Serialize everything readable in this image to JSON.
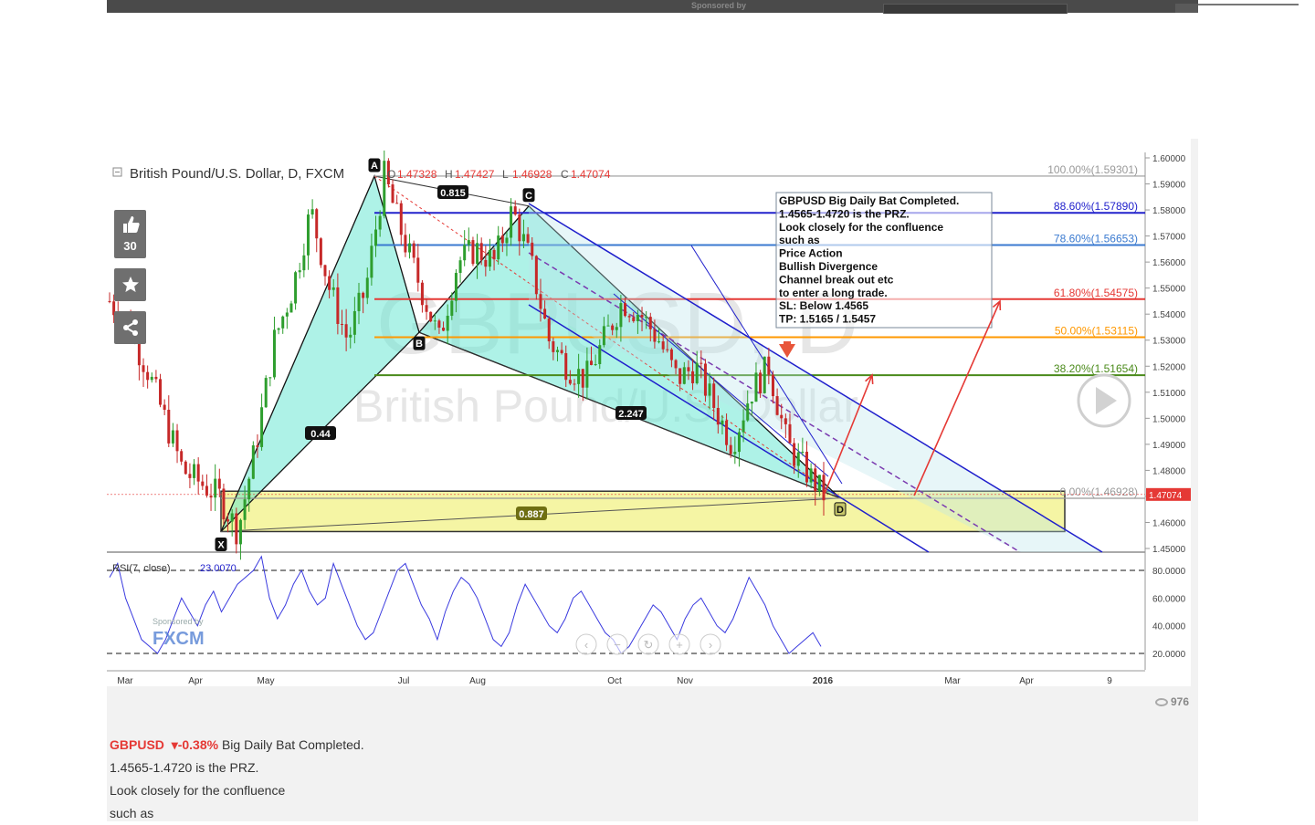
{
  "header": {
    "sponsored_label": "Sponsored by"
  },
  "chart": {
    "title": "British Pound/U.S. Dollar, D, FXCM",
    "ohlc": {
      "o_label": "O",
      "o": "1.47328",
      "h_label": "H",
      "h": "1.47427",
      "l_label": "L",
      "l": "1.46928",
      "c_label": "C",
      "c": "1.47074"
    },
    "watermark_symbol": "GBPUSD, D",
    "watermark_name": "British Pound/U.S. Dollar",
    "current_price": "1.47074",
    "rsi_label": "RSI(7, close)",
    "rsi_value": "23.0070",
    "sponsor_label": "Sponsored by",
    "sponsor_brand": "FXCM",
    "like_count": "30",
    "view_count": "976",
    "note_lines": [
      "GBPUSD Big Daily Bat Completed.",
      "1.4565-1.4720 is the PRZ.",
      "Look closely for the confluence",
      "such as",
      "Price Action",
      "Bullish Divergence",
      "Channel break out etc",
      "to enter a long trade.",
      "SL: Below 1.4565",
      "TP: 1.5165 / 1.5457"
    ],
    "colors": {
      "accent_red": "#e53935",
      "rsi_line": "#3a3adf",
      "fib_blue": "#2222cc",
      "fib_red": "#e53935",
      "fib_orange": "#ff9800",
      "fib_green": "#4a8a1a"
    }
  },
  "chart_data": [
    {
      "type": "candlestick",
      "title": "British Pound/U.S. Dollar, D, FXCM",
      "x_tick_labels": [
        "Mar",
        "Apr",
        "May",
        "Jul",
        "Aug",
        "Oct",
        "Nov",
        "2016",
        "Mar",
        "Apr",
        "9"
      ],
      "y_tick_labels": [
        "1.60000",
        "1.59000",
        "1.58000",
        "1.57000",
        "1.56000",
        "1.55000",
        "1.54000",
        "1.53000",
        "1.52000",
        "1.51000",
        "1.50000",
        "1.49000",
        "1.48000",
        "1.47000",
        "1.46000",
        "1.45000"
      ],
      "ylim": [
        1.45,
        1.6
      ],
      "grid": false,
      "close_path": [
        [
          "Mar",
          1.545
        ],
        [
          "Mar",
          1.535
        ],
        [
          "Mar",
          1.52
        ],
        [
          "Mar",
          1.5
        ],
        [
          "Apr",
          1.48
        ],
        [
          "Apr",
          1.475
        ],
        [
          "Apr",
          1.47
        ],
        [
          "Apr",
          1.4565
        ],
        [
          "May",
          1.49
        ],
        [
          "May",
          1.53
        ],
        [
          "May",
          1.55
        ],
        [
          "May",
          1.58
        ],
        [
          "May",
          1.55
        ],
        [
          "May",
          1.53
        ],
        [
          "Jun",
          1.55
        ],
        [
          "Jun",
          1.593
        ],
        [
          "Jun",
          1.57
        ],
        [
          "Jul",
          1.55
        ],
        [
          "Jul",
          1.53
        ],
        [
          "Jul",
          1.56
        ],
        [
          "Aug",
          1.565
        ],
        [
          "Aug",
          1.56
        ],
        [
          "Aug",
          1.58
        ],
        [
          "Sep",
          1.56
        ],
        [
          "Sep",
          1.53
        ],
        [
          "Sep",
          1.52
        ],
        [
          "Oct",
          1.515
        ],
        [
          "Oct",
          1.53
        ],
        [
          "Oct",
          1.545
        ],
        [
          "Nov",
          1.54
        ],
        [
          "Nov",
          1.53
        ],
        [
          "Nov",
          1.515
        ],
        [
          "Nov",
          1.52
        ],
        [
          "Dec",
          1.505
        ],
        [
          "Dec",
          1.49
        ],
        [
          "Dec",
          1.51
        ],
        [
          "Dec",
          1.52
        ],
        [
          "Dec",
          1.49
        ],
        [
          "Dec",
          1.48
        ],
        [
          "2016",
          1.47074
        ]
      ],
      "harmonic_points": [
        {
          "label": "X",
          "price": 1.4565
        },
        {
          "label": "A",
          "price": 1.593
        },
        {
          "label": "B",
          "price": 1.533
        },
        {
          "label": "C",
          "price": 1.5815
        },
        {
          "label": "D",
          "price": 1.4693
        }
      ],
      "ratios": [
        "0.815",
        "0.44",
        "2.247",
        "0.887"
      ],
      "fib_levels": [
        {
          "label": "100.00%(1.59301)",
          "price": 1.59301
        },
        {
          "label": "88.60%(1.57890)",
          "price": 1.5789
        },
        {
          "label": "78.60%(1.56653)",
          "price": 1.56653
        },
        {
          "label": "61.80%(1.54575)",
          "price": 1.54575
        },
        {
          "label": "50.00%(1.53115)",
          "price": 1.53115
        },
        {
          "label": "38.20%(1.51654)",
          "price": 1.51654
        },
        {
          "label": "0.00%(1.46928)",
          "price": 1.46928
        }
      ],
      "prz": [
        1.4565,
        1.472
      ]
    },
    {
      "type": "line",
      "title": "RSI(7, close)",
      "last_value": "23.0070",
      "y_tick_labels": [
        "80.0000",
        "60.0000",
        "40.0000",
        "20.0000"
      ],
      "ylim": [
        10,
        90
      ],
      "levels": [
        80,
        20
      ],
      "values": [
        75,
        85,
        60,
        45,
        30,
        25,
        20,
        30,
        45,
        60,
        50,
        40,
        55,
        65,
        50,
        60,
        70,
        75,
        80,
        90,
        60,
        45,
        55,
        70,
        80,
        65,
        55,
        60,
        85,
        70,
        55,
        40,
        30,
        35,
        50,
        65,
        80,
        85,
        70,
        55,
        45,
        30,
        50,
        65,
        75,
        70,
        60,
        45,
        30,
        25,
        35,
        55,
        70,
        60,
        50,
        40,
        35,
        45,
        60,
        65,
        55,
        45,
        35,
        30,
        20,
        25,
        35,
        45,
        55,
        50,
        40,
        30,
        45,
        55,
        60,
        50,
        40,
        35,
        45,
        60,
        75,
        65,
        55,
        40,
        30,
        20,
        25,
        30,
        35,
        25
      ]
    }
  ],
  "description": {
    "symbol": "GBPUSD",
    "change": "▾-0.38%",
    "lines": [
      "Big Daily Bat Completed.",
      "1.4565-1.4720 is the PRZ.",
      "Look closely for the confluence",
      "such as"
    ]
  }
}
